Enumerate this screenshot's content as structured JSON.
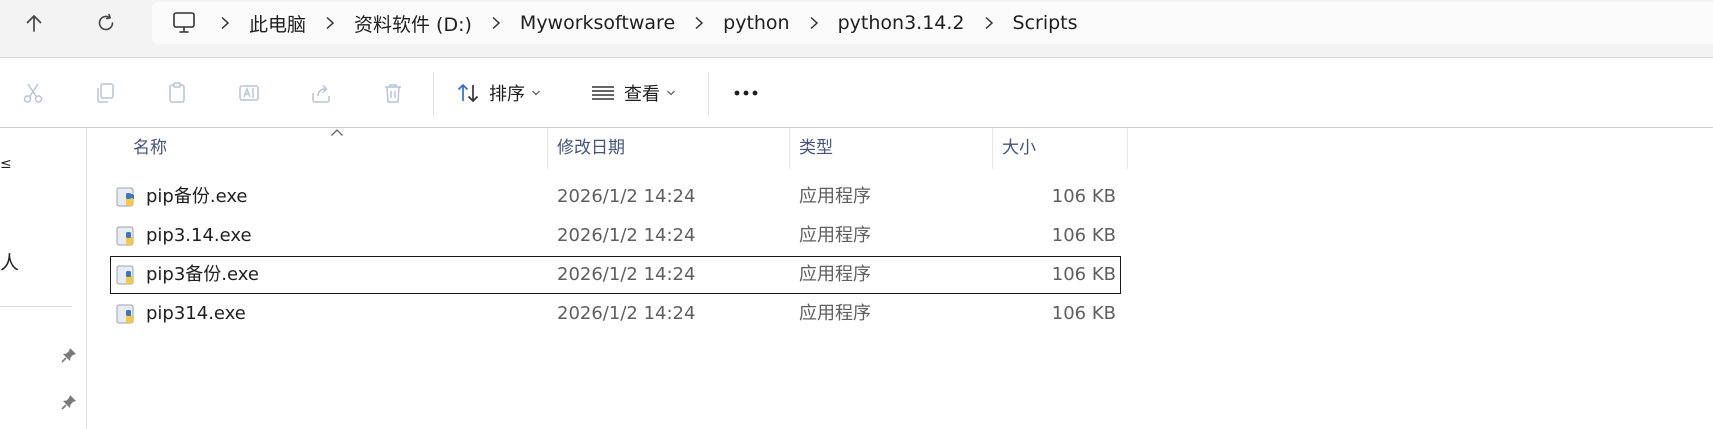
{
  "breadcrumb": [
    "此电脑",
    "资料软件 (D:)",
    "Myworksoftware",
    "python",
    "python3.14.2",
    "Scripts"
  ],
  "toolbar": {
    "sort_label": "排序",
    "view_label": "查看"
  },
  "sidebar": {
    "fragment_1": "≤",
    "fragment_2": "人"
  },
  "columns": [
    "名称",
    "修改日期",
    "类型",
    "大小"
  ],
  "files": [
    {
      "name": "pip备份.exe",
      "modified": "2026/1/2 14:24",
      "type": "应用程序",
      "size": "106 KB"
    },
    {
      "name": "pip3.14.exe",
      "modified": "2026/1/2 14:24",
      "type": "应用程序",
      "size": "106 KB"
    },
    {
      "name": "pip3备份.exe",
      "modified": "2026/1/2 14:24",
      "type": "应用程序",
      "size": "106 KB"
    },
    {
      "name": "pip314.exe",
      "modified": "2026/1/2 14:24",
      "type": "应用程序",
      "size": "106 KB"
    }
  ],
  "selected_index": 2,
  "colors": {
    "header_text": "#44557a",
    "disabled_icon": "#b9c4d6",
    "accent_blue": "#2f6fc9"
  }
}
